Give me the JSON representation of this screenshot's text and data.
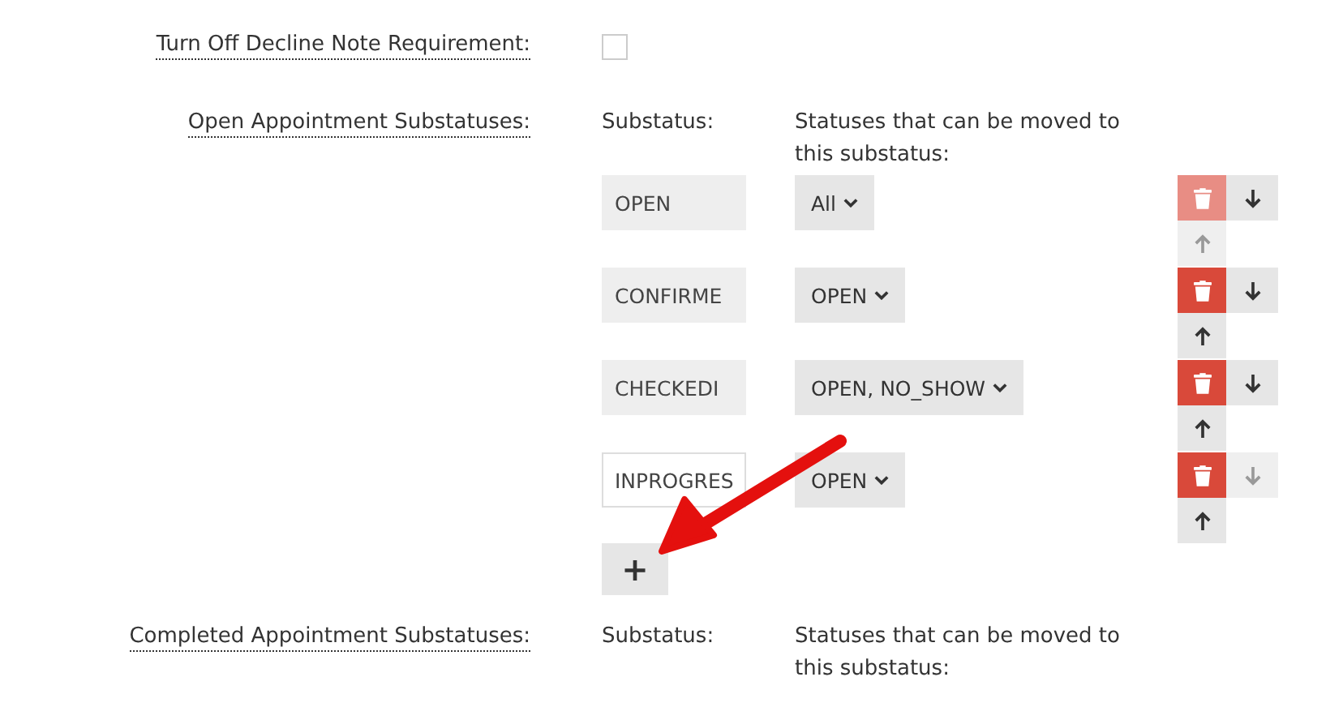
{
  "decline_note": {
    "label": "Turn Off Decline Note Requirement:",
    "checked": false
  },
  "sections": [
    {
      "label": "Open Appointment Substatuses:",
      "substatus_header": "Substatus:",
      "statuses_header": "Statuses that can be moved to this substatus:",
      "rows": [
        {
          "substatus": "OPEN",
          "editable": false,
          "statuses": "All",
          "delete_disabled": true,
          "down_disabled": false,
          "up_disabled": true
        },
        {
          "substatus": "CONFIRME",
          "editable": false,
          "statuses": "OPEN",
          "delete_disabled": false,
          "down_disabled": false,
          "up_disabled": false
        },
        {
          "substatus": "CHECKEDI",
          "editable": false,
          "statuses": "OPEN, NO_SHOW",
          "delete_disabled": false,
          "down_disabled": false,
          "up_disabled": false
        },
        {
          "substatus": "INPROGRES",
          "editable": true,
          "statuses": "OPEN",
          "delete_disabled": false,
          "down_disabled": true,
          "up_disabled": false
        }
      ],
      "add_button": "+"
    },
    {
      "label": "Completed Appointment Substatuses:",
      "substatus_header": "Substatus:",
      "statuses_header": "Statuses that can be moved to this substatus:"
    }
  ]
}
